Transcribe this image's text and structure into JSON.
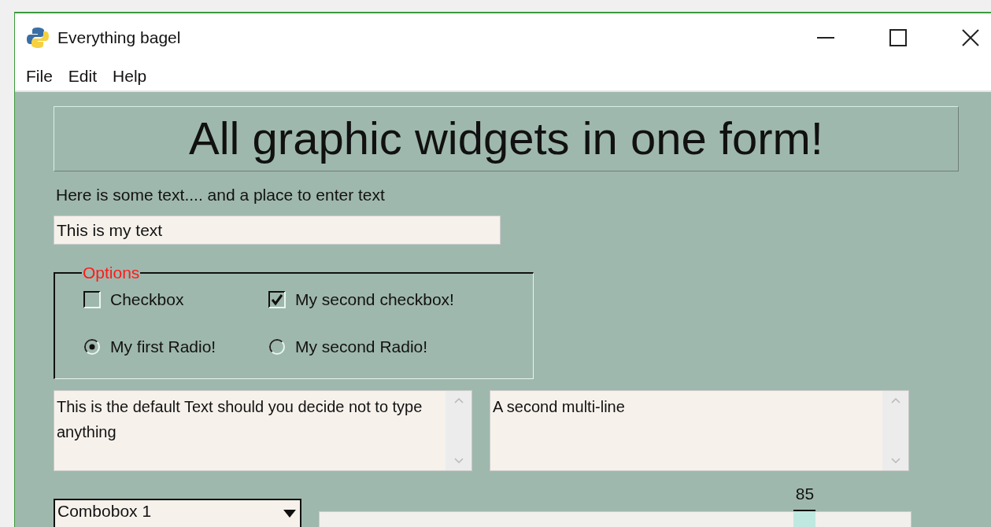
{
  "window": {
    "title": "Everything bagel"
  },
  "menu": [
    "File",
    "Edit",
    "Help"
  ],
  "heading": "All graphic widgets in one form!",
  "prompt": "Here is some text.... and a place to enter text",
  "text_input": {
    "value": "This is my text"
  },
  "options": {
    "title": "Options",
    "items": [
      {
        "kind": "checkbox",
        "label": "Checkbox",
        "checked": false
      },
      {
        "kind": "checkbox",
        "label": "My second checkbox!",
        "checked": true
      },
      {
        "kind": "radio",
        "label": "My first Radio!",
        "selected": true
      },
      {
        "kind": "radio",
        "label": "My second Radio!",
        "selected": false
      }
    ]
  },
  "multilines": [
    {
      "value": "This is the default Text should you decide not to type anything"
    },
    {
      "value": "A second multi-line"
    }
  ],
  "combobox": {
    "value": "Combobox 1"
  },
  "slider": {
    "level": 0.82,
    "reading": "85"
  }
}
